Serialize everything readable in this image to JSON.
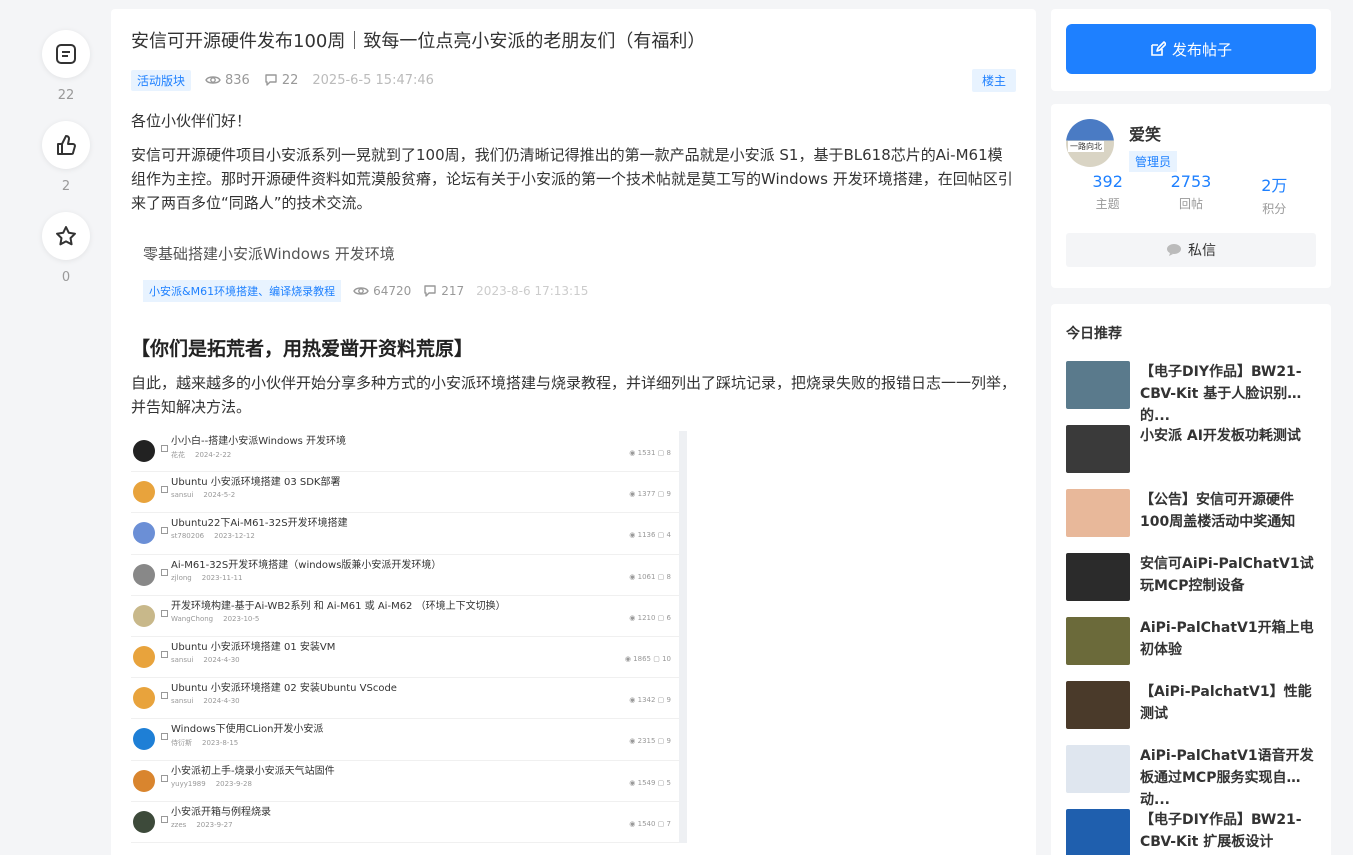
{
  "leftbar": {
    "comment_count": "22",
    "like_count": "2",
    "fav_count": "0"
  },
  "post": {
    "title": "安信可开源硬件发布100周｜致每一位点亮小安派的老朋友们（有福利）",
    "tag": "活动版块",
    "views": "836",
    "comments": "22",
    "time": "2025-6-5 15:47:46",
    "floor_badge": "楼主",
    "greeting": "各位小伙伴们好！",
    "para1": "安信可开源硬件项目小安派系列一晃就到了100周，我们仍清晰记得推出的第一款产品就是小安派 S1，基于BL618芯片的Ai-M61模组作为主控。那时开源硬件资料如荒漠般贫瘠，论坛有关于小安派的第一个技术帖就是莫工写的Windows 开发环境搭建，在回帖区引来了两百多位“同路人”的技术交流。",
    "ref": {
      "title": "零基础搭建小安派Windows 开发环境",
      "tag": "小安派&M61环境搭建、编译烧录教程",
      "views": "64720",
      "comments": "217",
      "time": "2023-8-6 17:13:15"
    },
    "heading": "【你们是拓荒者，用热爱凿开资料荒原】",
    "para2": "自此，越来越多的小伙伴开始分享多种方式的小安派环境搭建与烧录教程，并详细列出了踩坑记录，把烧录失败的报错日志一一列举，并告知解决方法。"
  },
  "list": [
    {
      "title": "小小白--搭建小安派Windows 开发环境",
      "author": "花花",
      "date": "2024-2-22",
      "views": "1531",
      "replies": "8",
      "color": "#222222"
    },
    {
      "title": "Ubuntu 小安派环境搭建 03 SDK部署",
      "author": "sansui",
      "date": "2024-5-2",
      "views": "1377",
      "replies": "9",
      "color": "#e8a33c"
    },
    {
      "title": "Ubuntu22下Ai-M61-32S开发环境搭建",
      "author": "st780206",
      "date": "2023-12-12",
      "views": "1136",
      "replies": "4",
      "color": "#6b8fd6"
    },
    {
      "title": "Ai-M61-32S开发环境搭建（windows版兼小安派开发环境）",
      "author": "zjlong",
      "date": "2023-11-11",
      "views": "1061",
      "replies": "8",
      "color": "#888888"
    },
    {
      "title": "开发环境构建-基于Ai-WB2系列 和 Ai-M61 或 Ai-M62 （环境上下文切换）",
      "author": "WangChong",
      "date": "2023-10-5",
      "views": "1210",
      "replies": "6",
      "color": "#c8b88a"
    },
    {
      "title": "Ubuntu 小安派环境搭建 01 安装VM",
      "author": "sansui",
      "date": "2024-4-30",
      "views": "1865",
      "replies": "10",
      "color": "#e8a33c"
    },
    {
      "title": "Ubuntu 小安派环境搭建 02 安装Ubuntu VScode",
      "author": "sansui",
      "date": "2024-4-30",
      "views": "1342",
      "replies": "9",
      "color": "#e8a33c"
    },
    {
      "title": "Windows下使用CLion开发小安派",
      "author": "侍衍斯",
      "date": "2023-8-15",
      "views": "2315",
      "replies": "9",
      "color": "#1e7fd6"
    },
    {
      "title": "小安派初上手-烧录小安派天气站固件",
      "author": "yuyy1989",
      "date": "2023-9-28",
      "views": "1549",
      "replies": "5",
      "color": "#d9852e"
    },
    {
      "title": "小安派开箱与例程烧录",
      "author": "zzes",
      "date": "2023-9-27",
      "views": "1540",
      "replies": "7",
      "color": "#3d4a3a"
    }
  ],
  "sidebar": {
    "publish_label": "发布帖子",
    "user": {
      "name": "爱笑",
      "role": "管理员",
      "avatar_text": "一路向北",
      "stats": [
        {
          "value": "392",
          "label": "主题"
        },
        {
          "value": "2753",
          "label": "回帖"
        },
        {
          "value": "2万",
          "label": "积分"
        }
      ],
      "message_label": "私信"
    },
    "recommend_title": "今日推荐",
    "recommend": [
      {
        "title": "【电子DIY作品】BW21-CBV-Kit 基于人脸识别的...",
        "color": "#5a7a8c"
      },
      {
        "title": "小安派 AI开发板功耗测试",
        "color": "#3a3a3a"
      },
      {
        "title": "【公告】安信可开源硬件100周盖楼活动中奖通知",
        "color": "#e8b89a"
      },
      {
        "title": "安信可AiPi-PalChatV1试玩MCP控制设备",
        "color": "#2b2b2b"
      },
      {
        "title": "AiPi-PalChatV1开箱上电初体验",
        "color": "#6b6a3a"
      },
      {
        "title": "【AiPi-PalchatV1】性能测试",
        "color": "#4a3a2a"
      },
      {
        "title": "AiPi-PalChatV1语音开发板通过MCP服务实现自动...",
        "color": "#dfe6ef"
      },
      {
        "title": "【电子DIY作品】BW21-CBV-Kit 扩展板设计",
        "color": "#1f5fae"
      }
    ]
  }
}
